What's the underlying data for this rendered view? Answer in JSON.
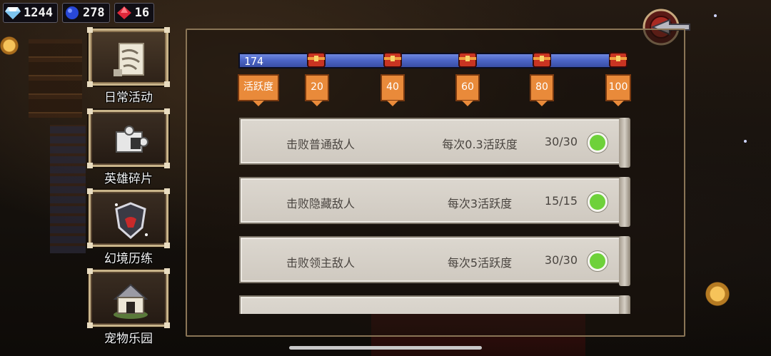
{
  "resources": [
    {
      "icon": "diamond-icon",
      "value": "1244"
    },
    {
      "icon": "blue-gem-icon",
      "value": "278"
    },
    {
      "icon": "red-gem-icon",
      "value": "16"
    }
  ],
  "side_menu": [
    {
      "label": "日常活动",
      "icon": "scroll-icon",
      "active": true
    },
    {
      "label": "英雄碎片",
      "icon": "puzzle-piece-icon",
      "active": false
    },
    {
      "label": "幻境历练",
      "icon": "shield-icon",
      "active": false
    },
    {
      "label": "宠物乐园",
      "icon": "doghouse-icon",
      "active": false
    }
  ],
  "activity": {
    "current": "174",
    "current_value": 174,
    "max_value": 100,
    "milestone_label": "活跃度",
    "milestones": [
      "20",
      "40",
      "60",
      "80",
      "100"
    ]
  },
  "tasks": [
    {
      "name": "击败普通敌人",
      "reward": "每次0.3活跃度",
      "progress": "30/30",
      "done": true
    },
    {
      "name": "击败隐藏敌人",
      "reward": "每次3活跃度",
      "progress": "15/15",
      "done": true
    },
    {
      "name": "击败领主敌人",
      "reward": "每次5活跃度",
      "progress": "30/30",
      "done": true
    }
  ],
  "colors": {
    "bar_fill": "#4a63c4",
    "tag_orange": "#e98a3a",
    "check_green": "#6ed13a"
  }
}
